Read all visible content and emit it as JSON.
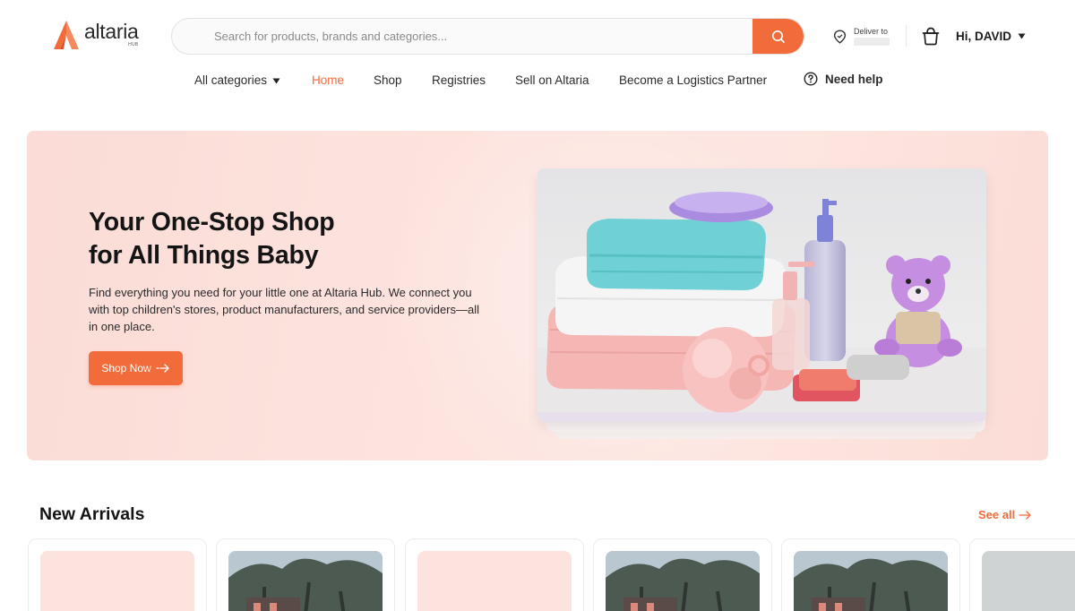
{
  "brand": {
    "name": "altaria",
    "sub": "HUB"
  },
  "search": {
    "placeholder": "Search for products, brands and categories...",
    "value": ""
  },
  "delivery": {
    "label": "Deliver to",
    "address": ""
  },
  "user": {
    "greeting": "Hi, DAVID"
  },
  "nav": {
    "items": [
      {
        "label": "All categories"
      },
      {
        "label": "Home",
        "active": true
      },
      {
        "label": "Shop"
      },
      {
        "label": "Registries"
      },
      {
        "label": "Sell on Altaria"
      },
      {
        "label": "Become a Logistics Partner"
      }
    ],
    "help_label": "Need help"
  },
  "hero": {
    "title_line1": "Your One-Stop Shop",
    "title_line2": "for All Things Baby",
    "description": "Find everything you need for your little one at Altaria Hub. We connect you with top children's stores, product manufacturers, and service providers—all in one place.",
    "cta_label": "Shop Now"
  },
  "new_arrivals": {
    "title": "New Arrivals",
    "see_all_label": "See all",
    "cards": [
      {
        "thumb": "pink"
      },
      {
        "thumb": "photo"
      },
      {
        "thumb": "pink"
      },
      {
        "thumb": "photo"
      },
      {
        "thumb": "photo"
      },
      {
        "thumb": "grey"
      }
    ]
  },
  "colors": {
    "accent": "#f26b3a",
    "hero_bg": "#fde4df",
    "text": "#1c1c1c"
  },
  "icons": {
    "logo": "altaria-a-logo-icon",
    "search": "search-icon",
    "location": "location-pin-icon",
    "cart": "shopping-bag-icon",
    "help": "help-circle-icon",
    "caret": "caret-down-icon",
    "arrow": "arrow-right-icon"
  }
}
